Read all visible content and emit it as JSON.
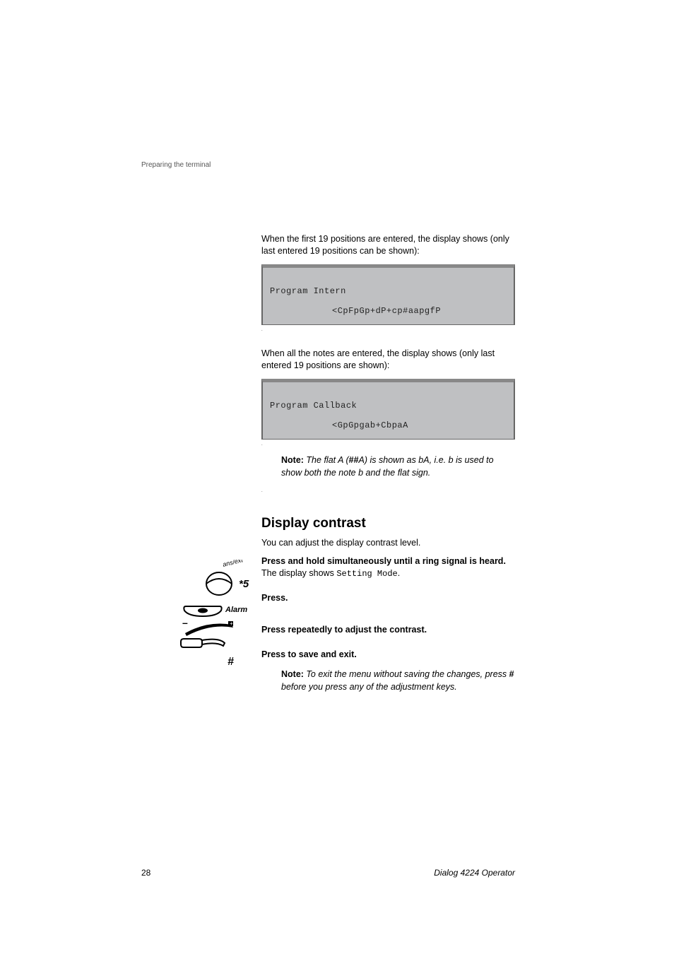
{
  "header": {
    "section": "Preparing the terminal"
  },
  "para1": "When the first 19 positions are entered, the display shows (only last entered 19 positions can be shown):",
  "lcd1": {
    "line1": "Program Intern",
    "line2": "<CpFpGp+dP+cp#aapgfP"
  },
  "para2": "When all the notes are entered, the display shows (only last entered 19 positions are shown):",
  "lcd2": {
    "line1": "Program Callback",
    "line2": "<GpGpgab+CbpaA"
  },
  "note1": {
    "label": "Note:",
    "text_before": " The flat A (",
    "hash": "##",
    "text_after": "A) is shown as bA, i.e. b is used to show both the note b and the flat sign."
  },
  "section": {
    "title": "Display contrast",
    "intro": "You can adjust the display contrast level."
  },
  "steps": {
    "s1_sym": "*5",
    "s1_bold": "Press and hold simultaneously until a ring signal is heard.",
    "s1_line2a": "The display shows ",
    "s1_line2b": "Setting Mode",
    "s1_line2c": ".",
    "s2_label": "Alarm",
    "s2_bold": "Press.",
    "s3_bold": "Press repeatedly to adjust the contrast.",
    "s4_sym": "#",
    "s4_bold": "Press to save and exit."
  },
  "note2": {
    "label": "Note:",
    "text_before": " To exit the menu without saving the changes, press ",
    "hash": "#",
    "text_after": " before you press any of the adjustment keys."
  },
  "footer": {
    "page": "28",
    "model": "Dialog 4224 Operator"
  }
}
